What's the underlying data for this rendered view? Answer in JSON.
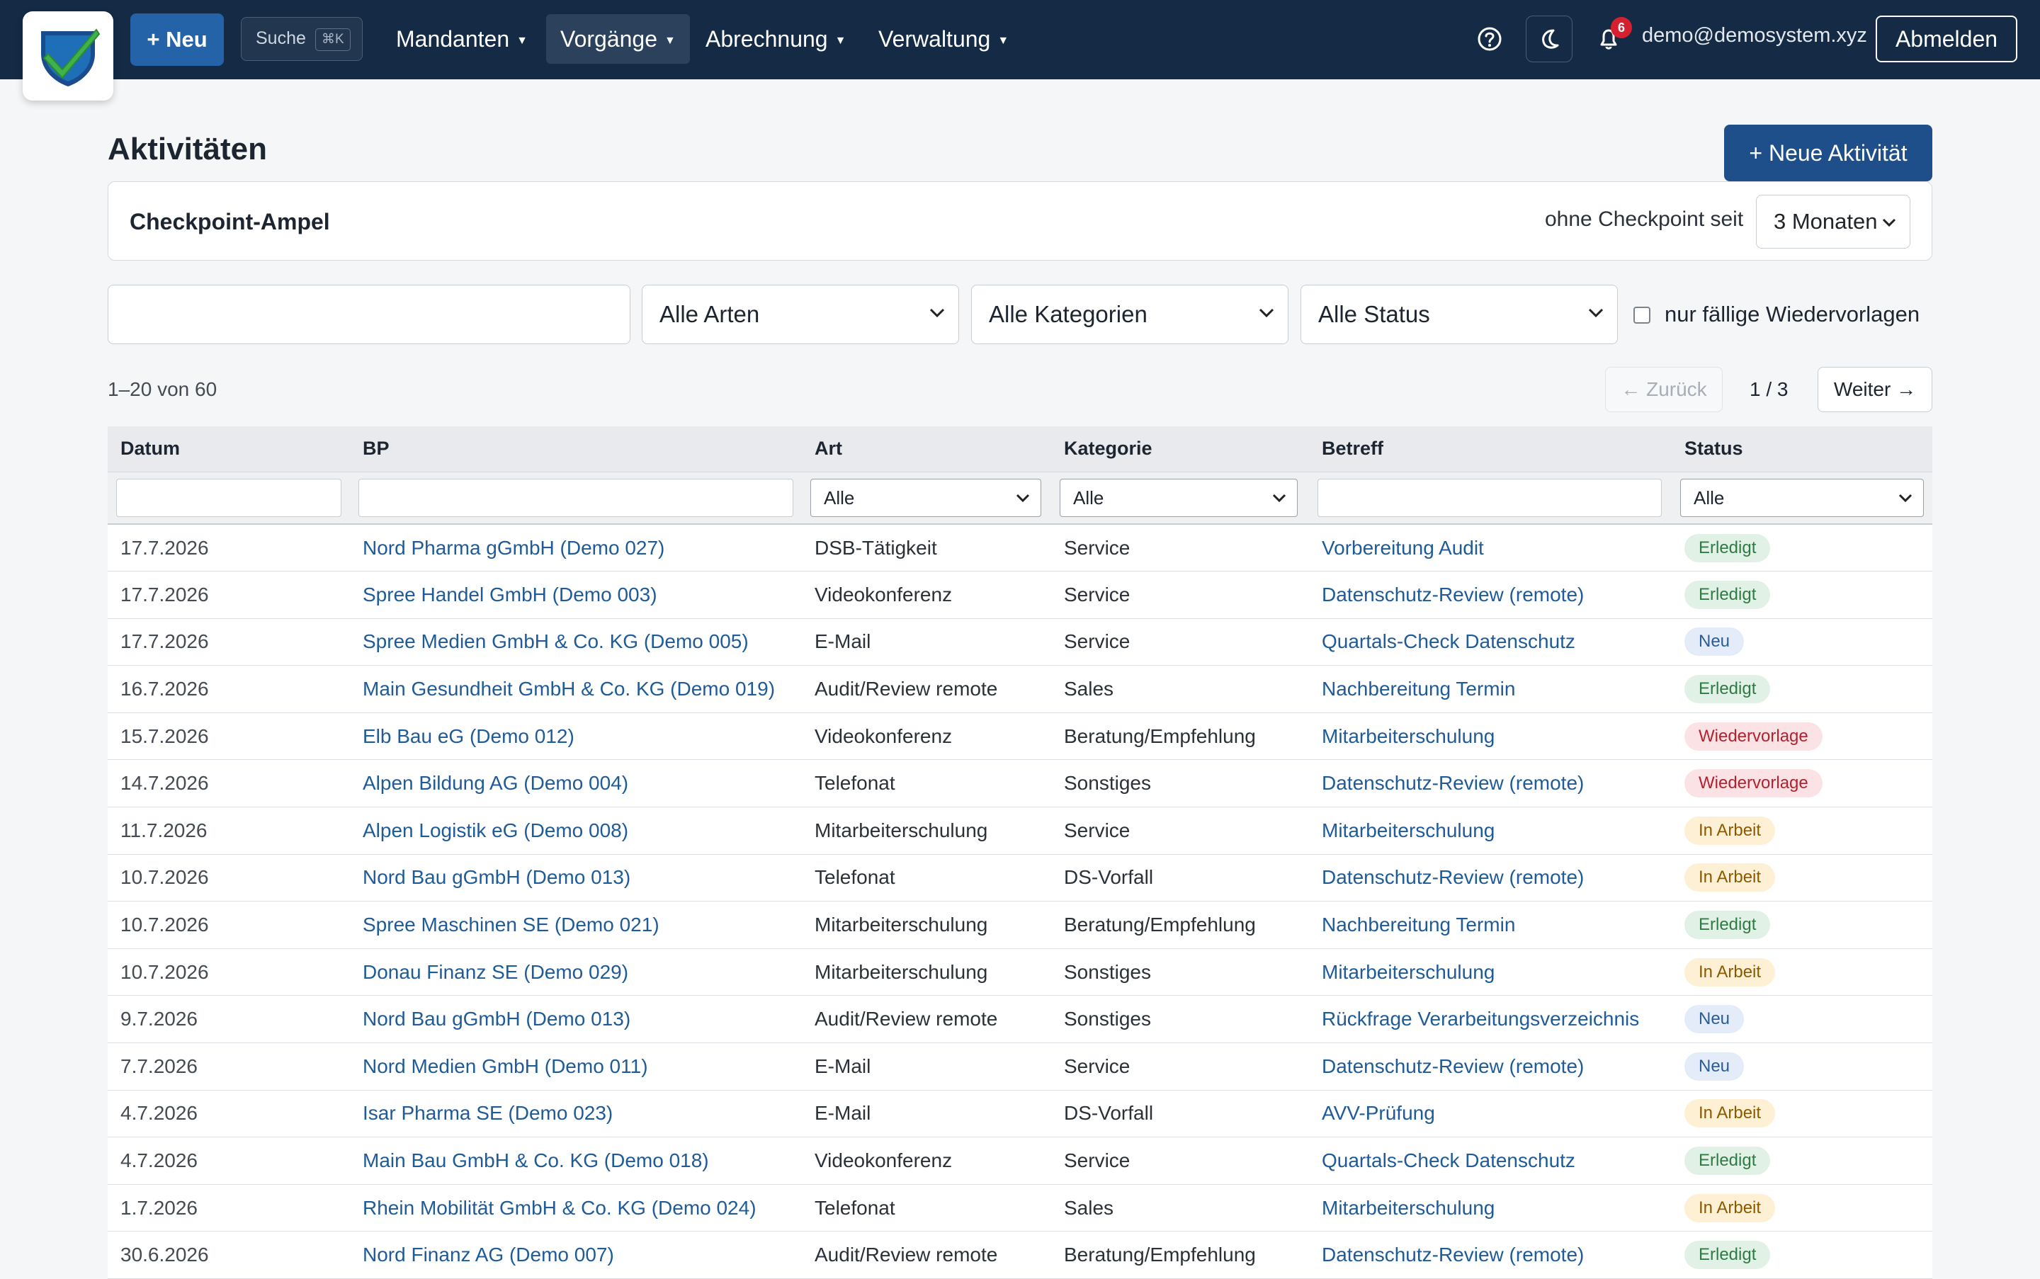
{
  "nav": {
    "new_button": "+ Neu",
    "search_label": "Suche",
    "search_shortcut": "⌘K",
    "items": [
      {
        "label": "Mandanten",
        "active": false
      },
      {
        "label": "Vorgänge",
        "active": true
      },
      {
        "label": "Abrechnung",
        "active": false
      },
      {
        "label": "Verwaltung",
        "active": false
      }
    ],
    "notification_count": "6",
    "user_email": "demo@demosystem.xyz",
    "logout_label": "Abmelden"
  },
  "page": {
    "title": "Aktivitäten",
    "new_activity_button": "+ Neue Aktivität"
  },
  "ampel": {
    "title": "Checkpoint-Ampel",
    "label": "ohne Checkpoint seit",
    "selected": "3 Monaten"
  },
  "filters": {
    "arten": "Alle Arten",
    "kategorien": "Alle Kategorien",
    "status": "Alle Status",
    "checkbox_label": "nur fällige Wiedervorlagen",
    "checkbox_checked": false
  },
  "pagination": {
    "count": "1–20 von 60",
    "prev": "← Zurück",
    "page": "1 / 3",
    "next": "Weiter →"
  },
  "table": {
    "headers": {
      "datum": "Datum",
      "bp": "BP",
      "art": "Art",
      "kategorie": "Kategorie",
      "betreff": "Betreff",
      "status": "Status"
    },
    "column_filters": {
      "art": "Alle",
      "kategorie": "Alle",
      "status": "Alle"
    },
    "rows": [
      {
        "datum": "17.7.2026",
        "bp": "Nord Pharma gGmbH (Demo 027)",
        "art": "DSB-Tätigkeit",
        "kategorie": "Service",
        "betreff": "Vorbereitung Audit",
        "status": "Erledigt"
      },
      {
        "datum": "17.7.2026",
        "bp": "Spree Handel GmbH (Demo 003)",
        "art": "Videokonferenz",
        "kategorie": "Service",
        "betreff": "Datenschutz-Review (remote)",
        "status": "Erledigt"
      },
      {
        "datum": "17.7.2026",
        "bp": "Spree Medien GmbH & Co. KG (Demo 005)",
        "art": "E-Mail",
        "kategorie": "Service",
        "betreff": "Quartals-Check Datenschutz",
        "status": "Neu"
      },
      {
        "datum": "16.7.2026",
        "bp": "Main Gesundheit GmbH & Co. KG (Demo 019)",
        "art": "Audit/Review remote",
        "kategorie": "Sales",
        "betreff": "Nachbereitung Termin",
        "status": "Erledigt"
      },
      {
        "datum": "15.7.2026",
        "bp": "Elb Bau eG (Demo 012)",
        "art": "Videokonferenz",
        "kategorie": "Beratung/Empfehlung",
        "betreff": "Mitarbeiterschulung",
        "status": "Wiedervorlage"
      },
      {
        "datum": "14.7.2026",
        "bp": "Alpen Bildung AG (Demo 004)",
        "art": "Telefonat",
        "kategorie": "Sonstiges",
        "betreff": "Datenschutz-Review (remote)",
        "status": "Wiedervorlage"
      },
      {
        "datum": "11.7.2026",
        "bp": "Alpen Logistik eG (Demo 008)",
        "art": "Mitarbeiterschulung",
        "kategorie": "Service",
        "betreff": "Mitarbeiterschulung",
        "status": "In Arbeit"
      },
      {
        "datum": "10.7.2026",
        "bp": "Nord Bau gGmbH (Demo 013)",
        "art": "Telefonat",
        "kategorie": "DS-Vorfall",
        "betreff": "Datenschutz-Review (remote)",
        "status": "In Arbeit"
      },
      {
        "datum": "10.7.2026",
        "bp": "Spree Maschinen SE (Demo 021)",
        "art": "Mitarbeiterschulung",
        "kategorie": "Beratung/Empfehlung",
        "betreff": "Nachbereitung Termin",
        "status": "Erledigt"
      },
      {
        "datum": "10.7.2026",
        "bp": "Donau Finanz SE (Demo 029)",
        "art": "Mitarbeiterschulung",
        "kategorie": "Sonstiges",
        "betreff": "Mitarbeiterschulung",
        "status": "In Arbeit"
      },
      {
        "datum": "9.7.2026",
        "bp": "Nord Bau gGmbH (Demo 013)",
        "art": "Audit/Review remote",
        "kategorie": "Sonstiges",
        "betreff": "Rückfrage Verarbeitungsverzeichnis",
        "status": "Neu"
      },
      {
        "datum": "7.7.2026",
        "bp": "Nord Medien GmbH (Demo 011)",
        "art": "E-Mail",
        "kategorie": "Service",
        "betreff": "Datenschutz-Review (remote)",
        "status": "Neu"
      },
      {
        "datum": "4.7.2026",
        "bp": "Isar Pharma SE (Demo 023)",
        "art": "E-Mail",
        "kategorie": "DS-Vorfall",
        "betreff": "AVV-Prüfung",
        "status": "In Arbeit"
      },
      {
        "datum": "4.7.2026",
        "bp": "Main Bau GmbH & Co. KG (Demo 018)",
        "art": "Videokonferenz",
        "kategorie": "Service",
        "betreff": "Quartals-Check Datenschutz",
        "status": "Erledigt"
      },
      {
        "datum": "1.7.2026",
        "bp": "Rhein Mobilität GmbH & Co. KG (Demo 024)",
        "art": "Telefonat",
        "kategorie": "Sales",
        "betreff": "Mitarbeiterschulung",
        "status": "In Arbeit"
      },
      {
        "datum": "30.6.2026",
        "bp": "Nord Finanz AG (Demo 007)",
        "art": "Audit/Review remote",
        "kategorie": "Beratung/Empfehlung",
        "betreff": "Datenschutz-Review (remote)",
        "status": "Erledigt"
      }
    ]
  },
  "status_colors": {
    "Erledigt": "#2f7a45",
    "Neu": "#2a5d98",
    "Wiedervorlage": "#b3202e",
    "In Arbeit": "#8a5a00"
  }
}
